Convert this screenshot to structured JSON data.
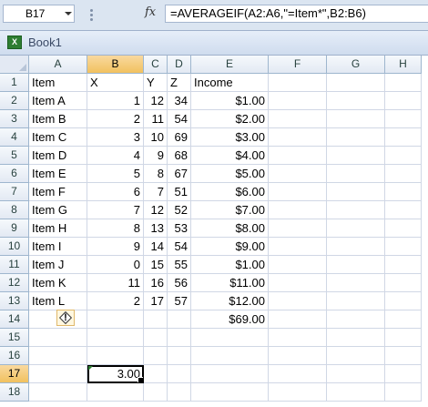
{
  "formula_bar": {
    "name_box": "B17",
    "fx_label": "fx",
    "formula": "=AVERAGEIF(A2:A6,\"=Item*\",B2:B6)"
  },
  "workbook": {
    "title": "Book1"
  },
  "columns": [
    "A",
    "B",
    "C",
    "D",
    "E",
    "F",
    "G",
    "H"
  ],
  "rows": [
    [
      "Item",
      "X",
      "Y",
      "Z",
      "Income"
    ],
    [
      "Item A",
      "1",
      "12",
      "34",
      "$1.00"
    ],
    [
      "Item B",
      "2",
      "11",
      "54",
      "$2.00"
    ],
    [
      "Item C",
      "3",
      "10",
      "69",
      "$3.00"
    ],
    [
      "Item D",
      "4",
      "9",
      "68",
      "$4.00"
    ],
    [
      "Item E",
      "5",
      "8",
      "67",
      "$5.00"
    ],
    [
      "Item F",
      "6",
      "7",
      "51",
      "$6.00"
    ],
    [
      "Item G",
      "7",
      "12",
      "52",
      "$7.00"
    ],
    [
      "Item H",
      "8",
      "13",
      "53",
      "$8.00"
    ],
    [
      "Item I",
      "9",
      "14",
      "54",
      "$9.00"
    ],
    [
      "Item J",
      "0",
      "15",
      "55",
      "$1.00"
    ],
    [
      "Item K",
      "11",
      "16",
      "56",
      "$11.00"
    ],
    [
      "Item L",
      "2",
      "17",
      "57",
      "$12.00"
    ],
    [
      "",
      "",
      "",
      "",
      "$69.00"
    ],
    [
      "",
      "",
      "",
      "",
      ""
    ],
    [
      "",
      "",
      "",
      "",
      ""
    ],
    [
      "",
      "3.00",
      "",
      "",
      ""
    ],
    [
      "",
      "",
      "",
      "",
      ""
    ]
  ],
  "row_numbers": [
    "1",
    "2",
    "3",
    "4",
    "5",
    "6",
    "7",
    "8",
    "9",
    "10",
    "11",
    "12",
    "13",
    "14",
    "15",
    "16",
    "17",
    "18"
  ],
  "selected": {
    "row": "17",
    "column": "B"
  },
  "error_indicator": {
    "icon": "warning-diamond-icon",
    "symbol": "!"
  }
}
